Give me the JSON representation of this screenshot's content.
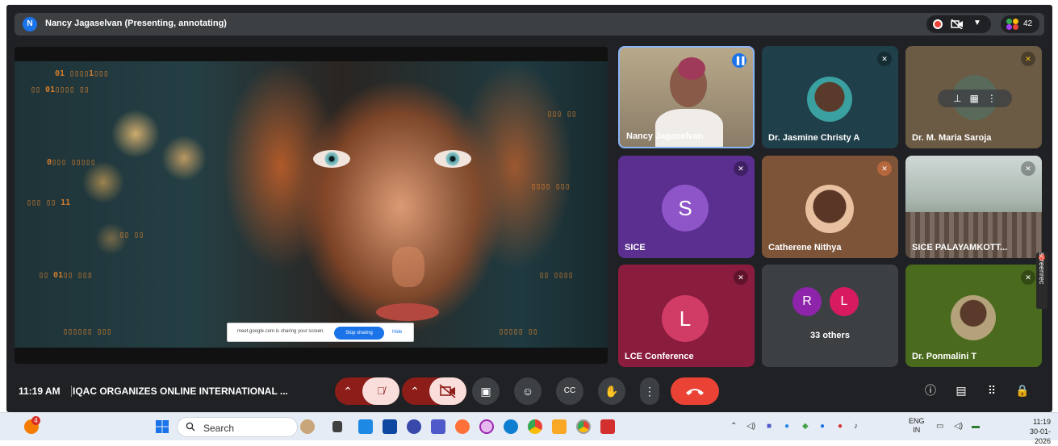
{
  "topbar": {
    "presenter_initial": "N",
    "presenter_label": "Nancy Jagaselvan (Presenting, annotating)",
    "people_count": "42"
  },
  "share": {
    "banner_text": "meet.google.com is sharing your screen.",
    "stop_label": "Stop sharing",
    "hide_label": "Hide"
  },
  "tiles": [
    {
      "name": "Nancy Jagaselvan",
      "state": "speaking"
    },
    {
      "name": "Dr. Jasmine Christy A",
      "state": "muted"
    },
    {
      "name": "Dr. M. Maria Saroja",
      "state": "muted"
    },
    {
      "name": "SICE",
      "initial": "S",
      "state": "muted"
    },
    {
      "name": "Catherene Nithya",
      "state": "muted"
    },
    {
      "name": "SICE PALAYAMKOTT...",
      "state": "muted"
    },
    {
      "name": "LCE Conference",
      "initial": "L",
      "state": "muted"
    },
    {
      "name": "33 others",
      "initials": [
        "R",
        "L"
      ]
    },
    {
      "name": "Dr. Ponmalini T",
      "state": "muted"
    }
  ],
  "bottombar": {
    "time": "11:19 AM",
    "meeting_title": "IQAC ORGANIZES ONLINE INTERNATIONAL ..."
  },
  "screenrec": "screenrec",
  "taskbar": {
    "notification_badge": "4",
    "search_placeholder": "Search",
    "lang_top": "ENG",
    "lang_bottom": "IN",
    "clock_time": "11:19",
    "clock_date": "30-01-2026"
  },
  "colors": {
    "meet_bg": "#202124",
    "end_call": "#ea4335",
    "mic_off_bg": "#f9dedc",
    "accent_blue": "#1a73e8"
  }
}
